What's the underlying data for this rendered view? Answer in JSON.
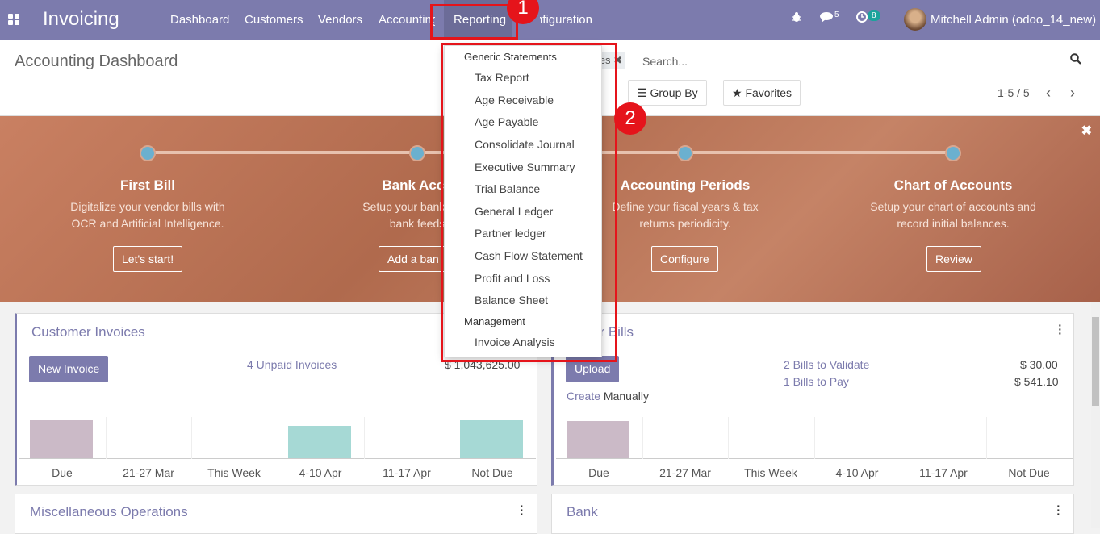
{
  "topbar": {
    "app_name": "Invoicing",
    "menu": [
      "Dashboard",
      "Customers",
      "Vendors",
      "Accounting",
      "Reporting",
      "Configuration"
    ],
    "messages_count": "5",
    "activities_count": "8",
    "user": "Mitchell Admin (odoo_14_new)"
  },
  "control_panel": {
    "title": "Accounting Dashboard",
    "facet": "rites",
    "search_placeholder": "Search...",
    "group_by": "Group By",
    "favorites": "Favorites",
    "pager": "1-5 / 5"
  },
  "banner": {
    "steps": [
      {
        "title": "First Bill",
        "desc1": "Digitalize your vendor bills with",
        "desc2": "OCR and Artificial Intelligence.",
        "button": "Let's start!"
      },
      {
        "title": "Bank Acco",
        "desc1": "Setup your bank acco",
        "desc2": "bank feeds",
        "button": "Add a ban"
      },
      {
        "title": "Accounting Periods",
        "desc1": "Define your fiscal years & tax",
        "desc2": "returns periodicity.",
        "button": "Configure"
      },
      {
        "title": "Chart of Accounts",
        "desc1": "Setup your chart of accounts and",
        "desc2": "record initial balances.",
        "button": "Review"
      }
    ]
  },
  "customer_invoices": {
    "title": "Customer Invoices",
    "new_button": "New Invoice",
    "unpaid": "4 Unpaid Invoices",
    "unpaid_amount": "$ 1,043,625.00",
    "chart_labels": [
      "Due",
      "21-27 Mar",
      "This Week",
      "4-10 Apr",
      "11-17 Apr",
      "Not Due"
    ]
  },
  "vendor_bills": {
    "title": "or Bills",
    "upload_button": "Upload",
    "create_link": "Create",
    "create_text": "Manually",
    "to_validate": "2 Bills to Validate",
    "to_validate_amount": "$ 30.00",
    "to_pay": "1 Bills to Pay",
    "to_pay_amount": "$ 541.10",
    "chart_labels": [
      "Due",
      "21-27 Mar",
      "This Week",
      "4-10 Apr",
      "11-17 Apr",
      "Not Due"
    ]
  },
  "misc": {
    "title": "Miscellaneous Operations"
  },
  "bank": {
    "title": "Bank"
  },
  "reporting_menu": {
    "section1": "Generic Statements",
    "items": [
      "Tax Report",
      "Age Receivable",
      "Age Payable",
      "Consolidate Journal",
      "Executive Summary",
      "Trial Balance",
      "General Ledger",
      "Partner ledger",
      "Cash Flow Statement",
      "Profit and Loss",
      "Balance Sheet"
    ],
    "section2": "Management",
    "items2": [
      "Invoice Analysis"
    ]
  },
  "annotations": {
    "step1": "1",
    "step2": "2"
  },
  "colors": {
    "brand": "#7c7bad",
    "highlight": "#e5141b",
    "teal": "#1ba39c"
  }
}
